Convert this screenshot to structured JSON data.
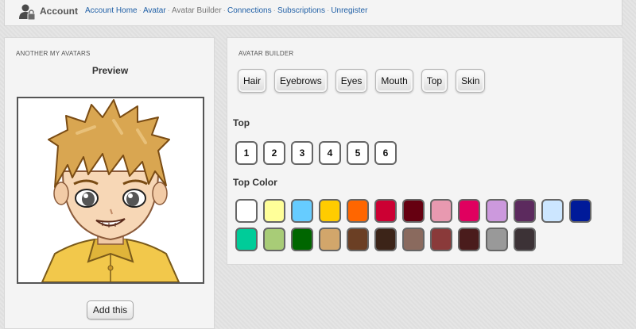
{
  "header": {
    "title": "Account",
    "breadcrumb": [
      {
        "label": "Account Home",
        "link": true
      },
      {
        "label": "Avatar",
        "link": true
      },
      {
        "label": "Avatar Builder",
        "link": false
      },
      {
        "label": "Connections",
        "link": true
      },
      {
        "label": "Subscriptions",
        "link": true
      },
      {
        "label": "Unregister",
        "link": true
      }
    ]
  },
  "left_panel": {
    "heading": "ANOTHER MY AVATARS",
    "preview_title": "Preview",
    "add_button": "Add this"
  },
  "builder": {
    "heading": "AVATAR BUILDER",
    "categories": [
      "Hair",
      "Eyebrows",
      "Eyes",
      "Mouth",
      "Top",
      "Skin"
    ],
    "top_label": "Top",
    "top_options": [
      "1",
      "2",
      "3",
      "4",
      "5",
      "6"
    ],
    "color_label": "Top Color",
    "colors": [
      "#ffffff",
      "#ffff99",
      "#66ccff",
      "#ffcc00",
      "#ff6600",
      "#cc0033",
      "#660011",
      "#e899b0",
      "#e0005f",
      "#cc99dd",
      "#5c2a5e",
      "#cce6ff",
      "#001a99",
      "#00cc99",
      "#a8cc77",
      "#006600",
      "#d2a66b",
      "#6b3f24",
      "#3c2418",
      "#8a6a5e",
      "#8a3a3a",
      "#4a1c1c",
      "#999999",
      "#3c3236"
    ]
  }
}
